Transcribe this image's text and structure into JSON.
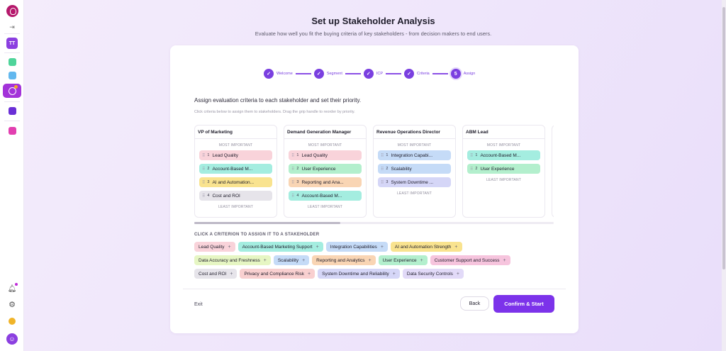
{
  "colors": {
    "accent": "#7c33ea",
    "pink": "#f9d3da",
    "teal": "#a4ede0",
    "yellow": "#f9e38f",
    "gray": "#e6e4ea",
    "green": "#b3efcd",
    "orange": "#f9d5b4",
    "blue": "#c5dbf7",
    "lavender": "#d5d6f7",
    "lime": "#e6f6c3",
    "rose": "#f6c4dd",
    "purple": "#e2daf8",
    "salmon": "#f9d0d0"
  },
  "sidebar": {
    "avatar_initials": "TT",
    "icons": [
      "logo-icon",
      "collapse-icon",
      "app-icon",
      "app-icon",
      "app-icon",
      "app-icon",
      "app-icon",
      "bell-icon",
      "gear-icon",
      "coin-icon",
      "user-icon"
    ]
  },
  "header": {
    "title": "Set up Stakeholder Analysis",
    "subtitle": "Evaluate how well you fit the buying criteria of key stakeholders - from decision makers to end users."
  },
  "stepper": {
    "steps": [
      {
        "label": "Welcome",
        "marker": "✓"
      },
      {
        "label": "Segment",
        "marker": "✓"
      },
      {
        "label": "ICP",
        "marker": "✓"
      },
      {
        "label": "Criteria",
        "marker": "✓"
      },
      {
        "label": "Assign",
        "marker": "5"
      }
    ]
  },
  "assign": {
    "heading": "Assign evaluation criteria to each stakeholder and set their priority.",
    "hint": "Click criteria below to assign them to stakeholders. Drag the grip handle to reorder by priority.",
    "most_important": "MOST IMPORTANT",
    "least_important": "LEAST IMPORTANT"
  },
  "stakeholders": [
    {
      "title": "VP of Marketing",
      "items": [
        {
          "num": "1",
          "label": "Lead Quality",
          "color": "#f9d3da"
        },
        {
          "num": "2",
          "label": "Account-Based M...",
          "color": "#a4ede0"
        },
        {
          "num": "3",
          "label": "AI and Automation...",
          "color": "#f9e38f"
        },
        {
          "num": "4",
          "label": "Cost and ROI",
          "color": "#e6e4ea"
        }
      ]
    },
    {
      "title": "Demand Generation Manager",
      "items": [
        {
          "num": "1",
          "label": "Lead Quality",
          "color": "#f9d3da"
        },
        {
          "num": "2",
          "label": "User Experience",
          "color": "#b3efcd"
        },
        {
          "num": "3",
          "label": "Reporting and Ana...",
          "color": "#f9d5b4"
        },
        {
          "num": "4",
          "label": "Account-Based M...",
          "color": "#a4ede0"
        }
      ]
    },
    {
      "title": "Revenue Operations Director",
      "items": [
        {
          "num": "1",
          "label": "Integration Capabi...",
          "color": "#c5dbf7"
        },
        {
          "num": "2",
          "label": "Scalability",
          "color": "#c5dbf7"
        },
        {
          "num": "3",
          "label": "System Downtime ...",
          "color": "#d5d6f7"
        }
      ]
    },
    {
      "title": "ABM Lead",
      "items": [
        {
          "num": "1",
          "label": "Account-Based M...",
          "color": "#a4ede0"
        },
        {
          "num": "2",
          "label": "User Experience",
          "color": "#b3efcd"
        }
      ]
    }
  ],
  "criteria": {
    "heading": "CLICK A CRITERION TO ASSIGN IT TO A STAKEHOLDER",
    "rows": [
      [
        {
          "label": "Lead Quality",
          "color": "#f9d3da"
        },
        {
          "label": "Account-Based Marketing Support",
          "color": "#a4ede0"
        },
        {
          "label": "Integration Capabilities",
          "color": "#c5dbf7"
        },
        {
          "label": "AI and Automation Strength",
          "color": "#f9e38f"
        }
      ],
      [
        {
          "label": "Data Accuracy and Freshness",
          "color": "#e6f6c3"
        },
        {
          "label": "Scalability",
          "color": "#c5dbf7"
        },
        {
          "label": "Reporting and Analytics",
          "color": "#f9d5b4"
        },
        {
          "label": "User Experience",
          "color": "#b3efcd"
        },
        {
          "label": "Customer Support and Success",
          "color": "#f6c4dd"
        }
      ],
      [
        {
          "label": "Cost and ROI",
          "color": "#e6e4ea"
        },
        {
          "label": "Privacy and Compliance Risk",
          "color": "#f9d0d0"
        },
        {
          "label": "System Downtime and Reliability",
          "color": "#d5d6f7"
        },
        {
          "label": "Data Security Controls",
          "color": "#e2daf8"
        }
      ]
    ],
    "plus": "+"
  },
  "footer": {
    "exit_label": "Exit",
    "back_label": "Back",
    "confirm_label": "Confirm & Start"
  }
}
